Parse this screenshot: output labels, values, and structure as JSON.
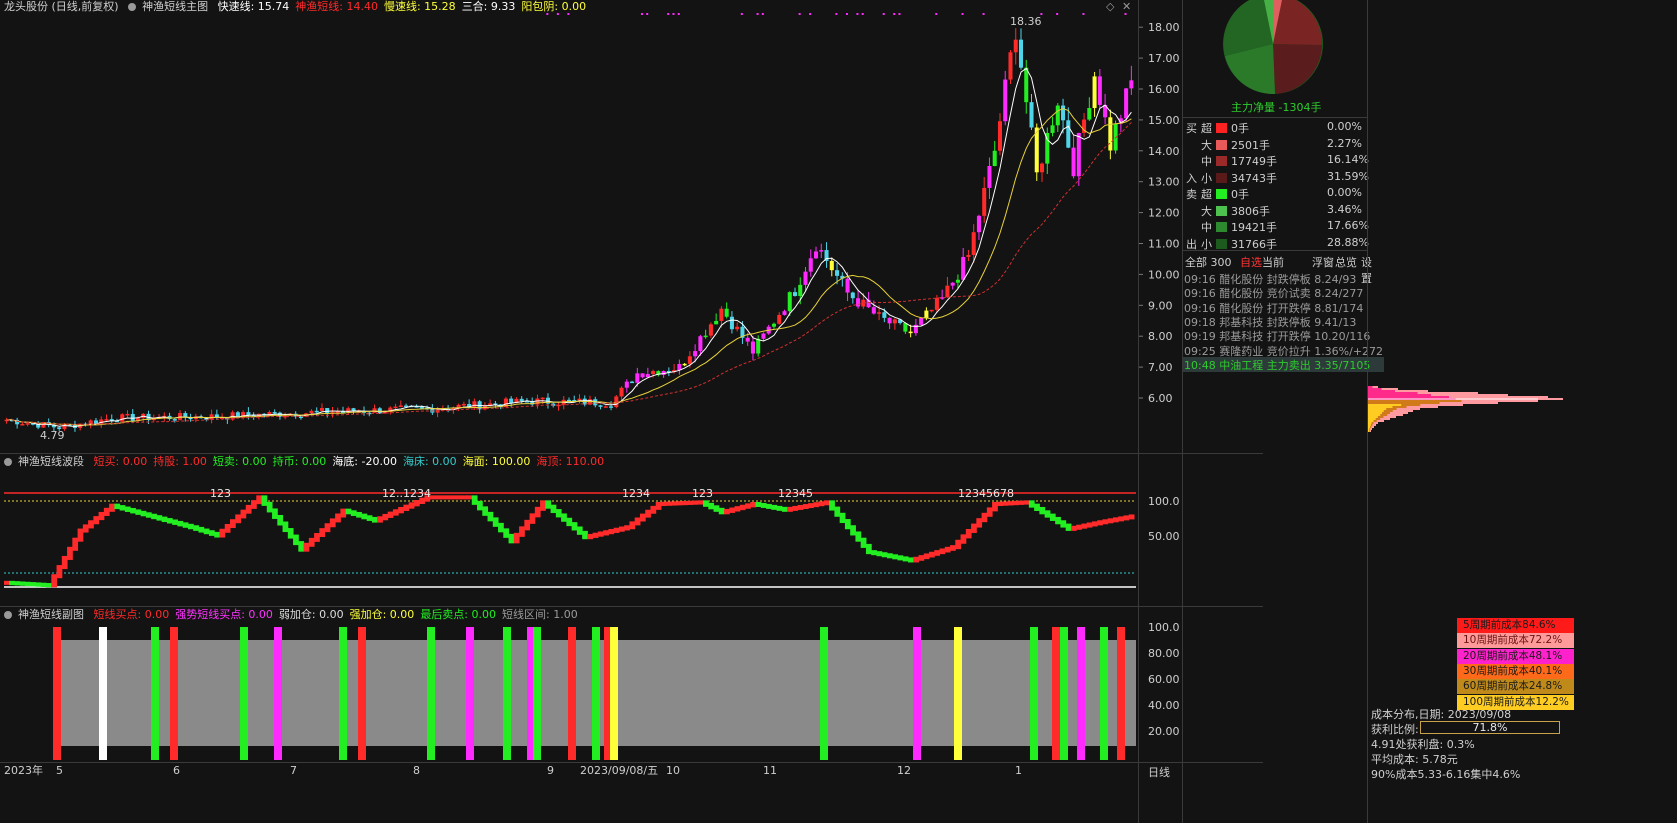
{
  "main": {
    "title": "龙头股份 (日线,前复权)",
    "indicator_name": "神渔短线主图",
    "params": [
      {
        "label": "快速线: 15.74",
        "color": "#ffffff"
      },
      {
        "label": "神渔短线: 14.40",
        "color": "#ff2a2a"
      },
      {
        "label": "慢速线: 15.28",
        "color": "#ffff3a"
      },
      {
        "label": "三合: 9.33",
        "color": "#ffffff"
      },
      {
        "label": "阳包阴: 0.00",
        "color": "#ffff3a"
      }
    ],
    "yticks": [
      "18.00",
      "17.00",
      "16.00",
      "15.00",
      "14.00",
      "13.00",
      "12.00",
      "11.00",
      "10.00",
      "9.00",
      "8.00",
      "7.00",
      "6.00"
    ],
    "high_label": "18.36",
    "low_label": "4.79"
  },
  "wave": {
    "indicator_name": "神渔短线波段",
    "params": [
      {
        "label": "短买: 0.00",
        "color": "#ff2a2a"
      },
      {
        "label": "持股: 1.00",
        "color": "#ff2a2a"
      },
      {
        "label": "短卖: 0.00",
        "color": "#22ee22"
      },
      {
        "label": "持币: 0.00",
        "color": "#22ee22"
      },
      {
        "label": "海底: -20.00",
        "color": "#ffffff"
      },
      {
        "label": "海床: 0.00",
        "color": "#33cccc"
      },
      {
        "label": "海面: 100.00",
        "color": "#ffff3a"
      },
      {
        "label": "海顶: 110.00",
        "color": "#ff2a2a"
      }
    ],
    "yticks": [
      "100.0",
      "50.00"
    ],
    "peak_labels": [
      "123",
      "12..1234",
      "1234",
      "123",
      "12345",
      "12345678"
    ]
  },
  "sub": {
    "indicator_name": "神渔短线副图",
    "params": [
      {
        "label": "短线买点: 0.00",
        "color": "#ff2a2a"
      },
      {
        "label": "强势短线买点: 0.00",
        "color": "#ff33ff"
      },
      {
        "label": "弱加仓: 0.00",
        "color": "#dddddd"
      },
      {
        "label": "强加仓: 0.00",
        "color": "#ffff3a"
      },
      {
        "label": "最后卖点: 0.00",
        "color": "#22ee22"
      },
      {
        "label": "短线区间: 1.00",
        "color": "#9b9b9b"
      }
    ],
    "yticks": [
      "100.0",
      "80.00",
      "60.00",
      "40.00",
      "20.00"
    ]
  },
  "xaxis": {
    "labels": [
      "2023年",
      "5",
      "6",
      "7",
      "8",
      "9",
      "2023/09/08/五",
      "10",
      "11",
      "12",
      "1"
    ],
    "period": "日线"
  },
  "fund_flow": {
    "main_net": "主力净量 -1304手",
    "buy_label": [
      "买",
      "入"
    ],
    "sell_label": [
      "卖",
      "出"
    ],
    "buy": [
      {
        "size": "超",
        "qty": "0手",
        "pct": "0.00%",
        "color": "#ff2222"
      },
      {
        "size": "大",
        "qty": "2501手",
        "pct": "2.27%",
        "color": "#e85a5a"
      },
      {
        "size": "中",
        "qty": "17749手",
        "pct": "16.14%",
        "color": "#9a2a2a"
      },
      {
        "size": "小",
        "qty": "34743手",
        "pct": "31.59%",
        "color": "#5a1a1a"
      }
    ],
    "sell": [
      {
        "size": "超",
        "qty": "0手",
        "pct": "0.00%",
        "color": "#22ee22"
      },
      {
        "size": "大",
        "qty": "3806手",
        "pct": "3.46%",
        "color": "#4ec24e"
      },
      {
        "size": "中",
        "qty": "19421手",
        "pct": "17.66%",
        "color": "#2e8a2e"
      },
      {
        "size": "小",
        "qty": "31766手",
        "pct": "28.88%",
        "color": "#1d5a1d"
      }
    ]
  },
  "tabs": [
    {
      "label": "全部 300",
      "color": "#cfcfcf"
    },
    {
      "label": "自选",
      "color": "#ff3333"
    },
    {
      "label": "当前",
      "color": "#cfcfcf"
    },
    {
      "label": "浮窗",
      "color": "#cfcfcf"
    },
    {
      "label": "总览",
      "color": "#cfcfcf"
    },
    {
      "label": "设置",
      "color": "#cfcfcf"
    }
  ],
  "ticker": [
    {
      "text": "09:16 醋化股份  封跌停板  8.24/93"
    },
    {
      "text": "09:16 醋化股份  竞价试卖  8.24/277"
    },
    {
      "text": "09:16 醋化股份  打开跌停  8.81/174"
    },
    {
      "text": "09:18 邦基科技  封跌停板  9.41/13"
    },
    {
      "text": "09:19 邦基科技  打开跌停  10.20/116"
    },
    {
      "text": "09:25 赛隆药业  竞价拉升  1.36%/+272"
    },
    {
      "text": "10:48 中油工程  主力卖出  3.35/7105"
    }
  ],
  "cost": {
    "legend": [
      {
        "label": "5周期前成本84.6%",
        "color": "#ff1a1a"
      },
      {
        "label": "10周期前成本72.2%",
        "color": "#ff9a9a"
      },
      {
        "label": "20周期前成本48.1%",
        "color": "#ff22cc"
      },
      {
        "label": "30周期前成本40.1%",
        "color": "#ff6a1a"
      },
      {
        "label": "60周期前成本24.8%",
        "color": "#c08a1a"
      },
      {
        "label": "100周期前成本12.2%",
        "color": "#ffcc22"
      }
    ],
    "date": "成本分布,日期: 2023/09/08",
    "profit_label": "获利比例:",
    "profit_ratio": 0.718,
    "profit_text": "71.8%",
    "profit_at": "4.91处获利盘: 0.3%",
    "avg_cost": "平均成本: 5.78元",
    "range": "90%成本5.33-6.16集中4.6%"
  }
}
